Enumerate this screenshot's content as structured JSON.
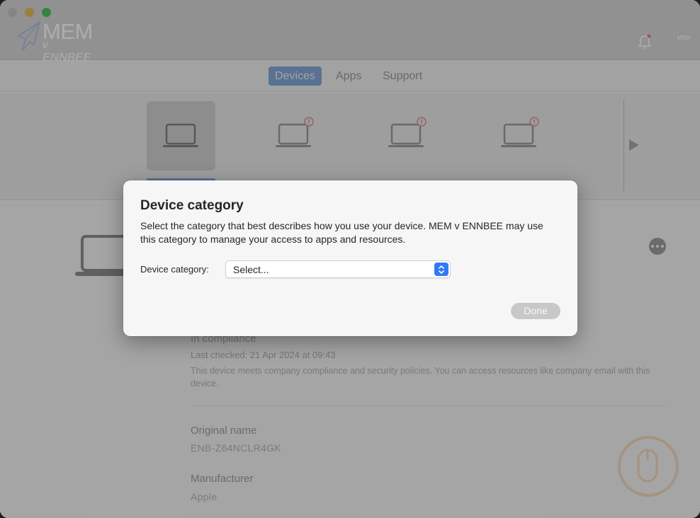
{
  "app": {
    "logo_line1": "MEM",
    "logo_line2": "v ENNBEE",
    "avatar_text": "MEM"
  },
  "tabs": [
    {
      "label": "Devices",
      "active": true
    },
    {
      "label": "Apps",
      "active": false
    },
    {
      "label": "Support",
      "active": false
    }
  ],
  "devices_strip": {
    "tiles": [
      {
        "icon": "laptop-icon",
        "warning": false,
        "selected": true
      },
      {
        "icon": "laptop-icon",
        "warning": true,
        "selected": false
      },
      {
        "icon": "laptop-icon",
        "warning": true,
        "selected": false
      },
      {
        "icon": "laptop-icon",
        "warning": true,
        "selected": false
      }
    ],
    "next_icon": "chevron-right-icon"
  },
  "device_detail": {
    "compliance_status": "In compliance",
    "last_checked": "Last checked: 21 Apr 2024 at 09:43",
    "compliance_description": "This device meets company compliance and security policies. You can access resources like company email with this device.",
    "fields": [
      {
        "label": "Original name",
        "value": "ENB-Z64NCLR4GK"
      },
      {
        "label": "Manufacturer",
        "value": "Apple"
      }
    ]
  },
  "modal": {
    "title": "Device category",
    "description": "Select the category that best describes how you use your device. MEM v ENNBEE may use this category to manage your access to apps and resources.",
    "field_label": "Device category:",
    "select_value": "Select...",
    "done_label": "Done"
  },
  "colors": {
    "accent": "#6f99cf",
    "select_stepper": "#2f7bf5",
    "traffic_min": "#e0b23a",
    "traffic_max": "#33b34a"
  }
}
